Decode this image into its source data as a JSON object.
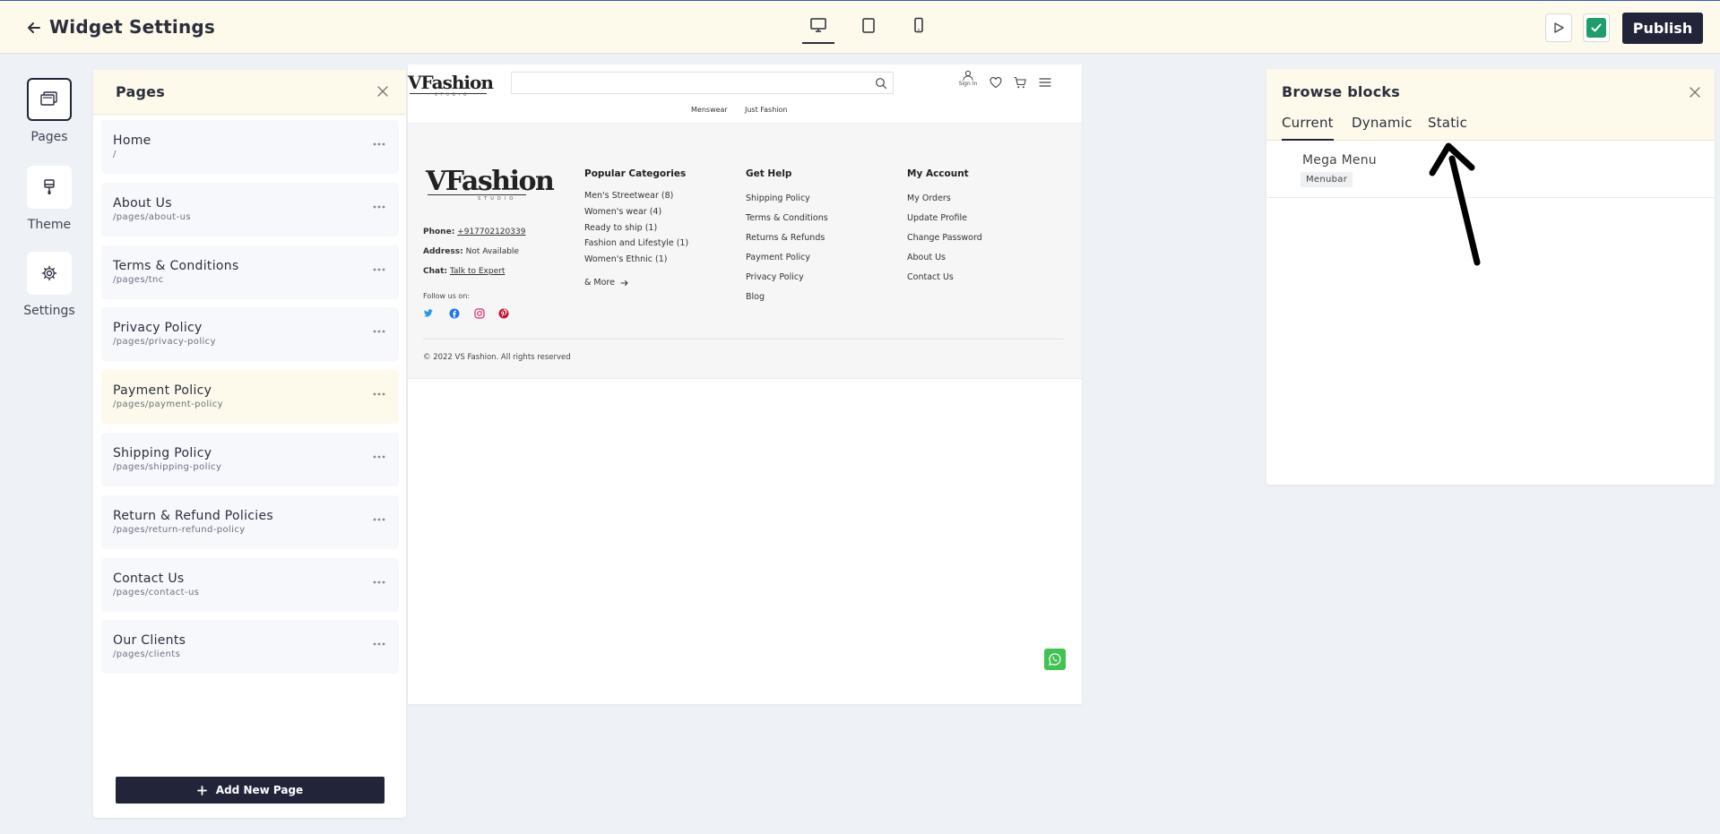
{
  "header": {
    "title": "Widget Settings",
    "publish_label": "Publish"
  },
  "rail": {
    "pages_label": "Pages",
    "theme_label": "Theme",
    "settings_label": "Settings"
  },
  "pages_panel": {
    "title": "Pages",
    "items": [
      {
        "name": "Home",
        "path": "/"
      },
      {
        "name": "About Us",
        "path": "/pages/about-us"
      },
      {
        "name": "Terms & Conditions",
        "path": "/pages/tnc"
      },
      {
        "name": "Privacy Policy",
        "path": "/pages/privacy-policy"
      },
      {
        "name": "Payment Policy",
        "path": "/pages/payment-policy"
      },
      {
        "name": "Shipping Policy",
        "path": "/pages/shipping-policy"
      },
      {
        "name": "Return & Refund Policies",
        "path": "/pages/return-refund-policy"
      },
      {
        "name": "Contact Us",
        "path": "/pages/contact-us"
      },
      {
        "name": "Our Clients",
        "path": "/pages/clients"
      }
    ],
    "active_index": 4,
    "add_label": "Add New Page"
  },
  "preview": {
    "logo": "VFashion",
    "logo_sub": "STUDIO",
    "signin": "Sign In",
    "nav": [
      "Menswear",
      "Just Fashion"
    ],
    "footer": {
      "phone_label": "Phone:",
      "phone_value": "+917702120339",
      "address_label": "Address:",
      "address_value": "Not Available",
      "chat_label": "Chat:",
      "chat_value": "Talk to Expert",
      "follow": "Follow us on:",
      "col1_title": "Popular Categories",
      "col1_links": [
        "Men's Streetwear (8)",
        "Women's wear (4)",
        "Ready to ship (1)",
        "Fashion and Lifestyle (1)",
        "Women's Ethnic (1)",
        "& More"
      ],
      "col2_title": "Get Help",
      "col2_links": [
        "Shipping Policy",
        "Terms & Conditions",
        "Returns & Refunds",
        "Payment Policy",
        "Privacy Policy",
        "Blog"
      ],
      "col3_title": "My Account",
      "col3_links": [
        "My Orders",
        "Update Profile",
        "Change Password",
        "About Us",
        "Contact Us"
      ],
      "copyright": "© 2022 VS Fashion. All rights reserved"
    }
  },
  "blocks_panel": {
    "title": "Browse blocks",
    "tabs": [
      "Current",
      "Dynamic",
      "Static"
    ],
    "active_tab": 0,
    "items": [
      {
        "name": "Mega Menu",
        "badge": "Menubar"
      }
    ]
  },
  "colors": {
    "accent_dark": "#22253a",
    "header_bg": "#fdfaeb",
    "success": "#1f9d6d",
    "whatsapp": "#43c153"
  }
}
